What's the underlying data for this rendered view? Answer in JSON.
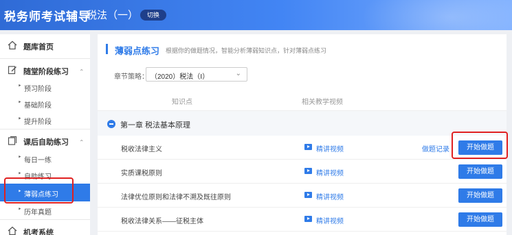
{
  "header": {
    "app_title": "税务师考试辅导",
    "subject": "税法（一）",
    "switch_label": "切换"
  },
  "sidebar": {
    "home": "题库首页",
    "stage_practice": {
      "label": "随堂阶段练习",
      "items": [
        "预习阶段",
        "基础阶段",
        "提升阶段"
      ]
    },
    "self_practice": {
      "label": "课后自助练习",
      "items": [
        "每日一练",
        "自助练习",
        "薄弱点练习",
        "历年真题"
      ]
    },
    "exam_system": "机考系统",
    "active_item": "薄弱点练习"
  },
  "main": {
    "section_title": "薄弱点练习",
    "section_desc": "根据你的做题情况，智能分析薄弱知识点，针对薄弱点练习",
    "filter_label": "章节策略：",
    "filter_value": "（2020）税法（Ⅰ）",
    "col_knowledge": "知识点",
    "col_video": "相关教学视频",
    "chapter_title": "第一章 税法基本原理",
    "video_label": "精讲视频",
    "record_label": "做题记录",
    "start_label": "开始做题",
    "rows": [
      {
        "name": "税收法律主义",
        "show_record": true
      },
      {
        "name": "实质课税原则",
        "show_record": false
      },
      {
        "name": "法律优位原则和法律不溯及既往原则",
        "show_record": false
      },
      {
        "name": "税收法律关系——征税主体",
        "show_record": false
      }
    ]
  },
  "colors": {
    "accent": "#2f7be8",
    "highlight": "#e02020"
  }
}
